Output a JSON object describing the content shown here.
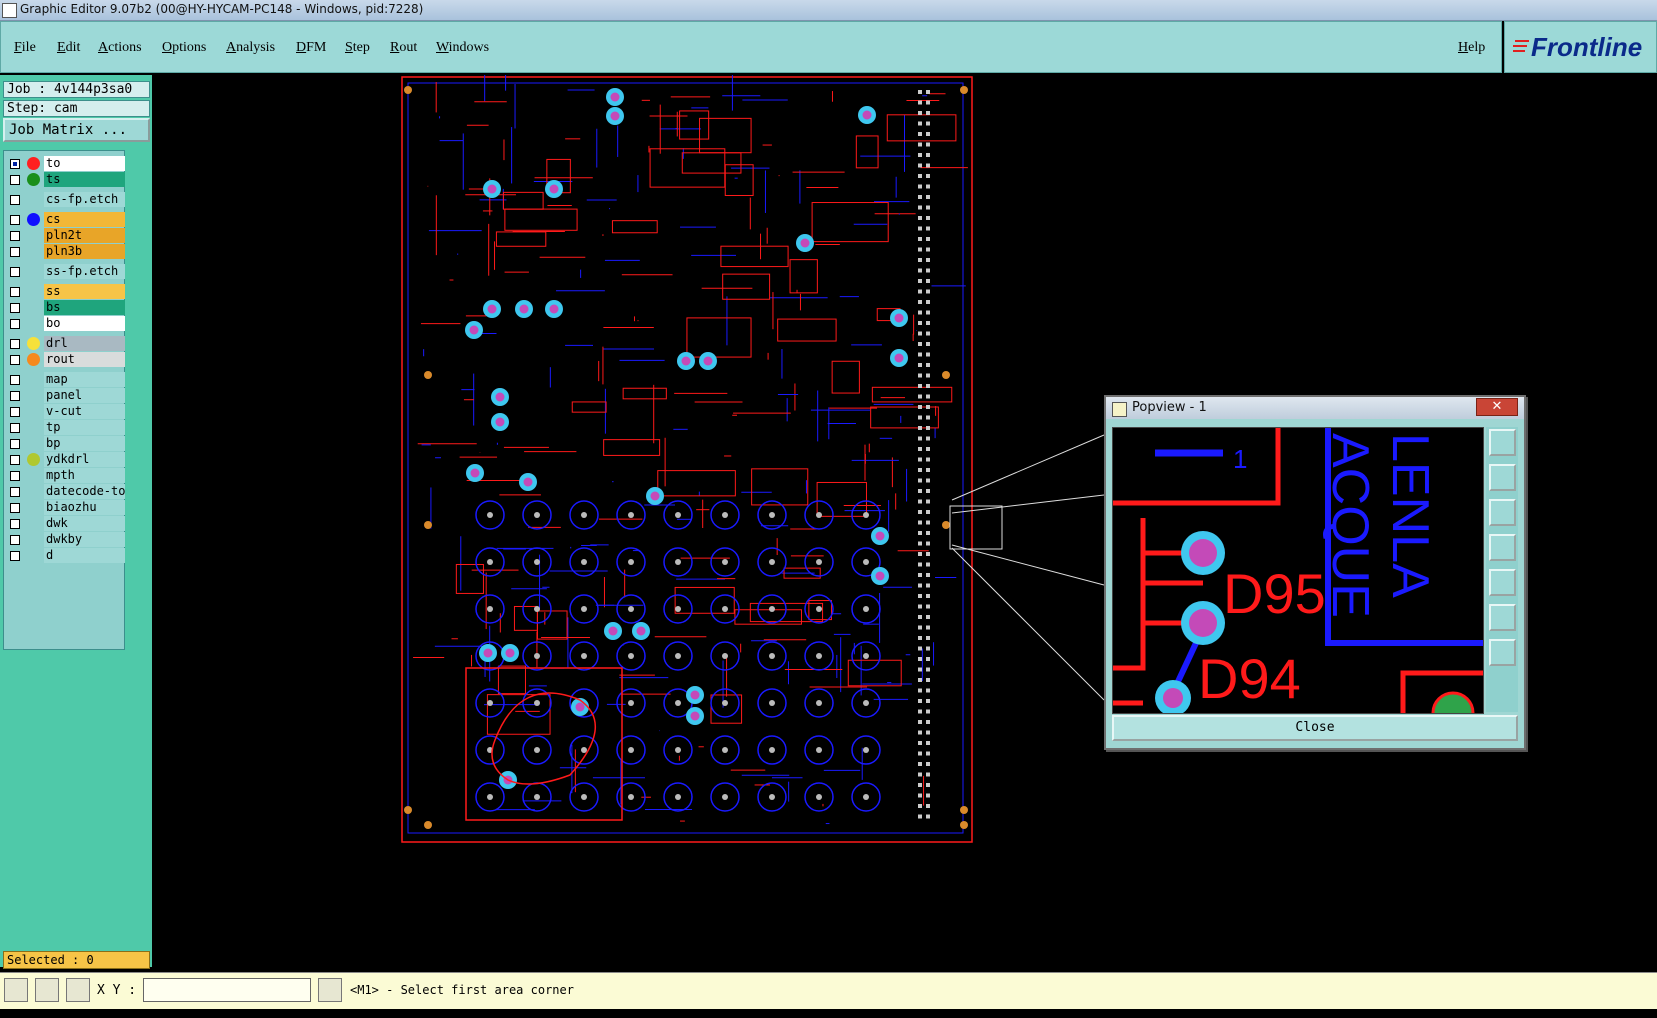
{
  "window": {
    "title": "Graphic Editor 9.07b2 (00@HY-HYCAM-PC148 - Windows, pid:7228)"
  },
  "menu": {
    "items": [
      {
        "label": "File"
      },
      {
        "label": "Edit"
      },
      {
        "label": "Actions"
      },
      {
        "label": "Options"
      },
      {
        "label": "Analysis"
      },
      {
        "label": "DFM"
      },
      {
        "label": "Step"
      },
      {
        "label": "Rout"
      },
      {
        "label": "Windows"
      }
    ],
    "help": "Help"
  },
  "brand": {
    "logo_text": "Frontline"
  },
  "job": {
    "job_line": "Job : 4v144p3sa0",
    "step_line": "Step: cam",
    "matrix_button": "Job Matrix ..."
  },
  "layers": [
    {
      "name": "to",
      "bg": "#ffffff",
      "dot": "#ff2020",
      "checked": true
    },
    {
      "name": "ts",
      "bg": "#1fa57d",
      "dot": "#1a8f1a",
      "checked": false
    },
    {
      "name": "cs-fp.etch",
      "bg": "#9ed8d6",
      "dot": "",
      "checked": false
    },
    {
      "name": "cs",
      "bg": "#f2b737",
      "dot": "#1010ff",
      "checked": false
    },
    {
      "name": "pln2t",
      "bg": "#e8a528",
      "dot": "",
      "checked": false
    },
    {
      "name": "pln3b",
      "bg": "#e8a528",
      "dot": "",
      "checked": false
    },
    {
      "name": "ss-fp.etch",
      "bg": "#9ed8d6",
      "dot": "",
      "checked": false
    },
    {
      "name": "ss",
      "bg": "#f6c447",
      "dot": "",
      "checked": false
    },
    {
      "name": "bs",
      "bg": "#1fa57d",
      "dot": "",
      "checked": false
    },
    {
      "name": "bo",
      "bg": "#ffffff",
      "dot": "",
      "checked": false
    },
    {
      "name": "drl",
      "bg": "#a9b9c2",
      "dot": "#f6e13a",
      "checked": false
    },
    {
      "name": "rout",
      "bg": "#d9dcdc",
      "dot": "#f5891e",
      "checked": false
    },
    {
      "name": "map",
      "bg": "#9ed8d6",
      "dot": "",
      "checked": false
    },
    {
      "name": "panel",
      "bg": "#9ed8d6",
      "dot": "",
      "checked": false
    },
    {
      "name": "v-cut",
      "bg": "#9ed8d6",
      "dot": "",
      "checked": false
    },
    {
      "name": "tp",
      "bg": "#9ed8d6",
      "dot": "",
      "checked": false
    },
    {
      "name": "bp",
      "bg": "#9ed8d6",
      "dot": "",
      "checked": false
    },
    {
      "name": "ydkdrl",
      "bg": "#9ed8d6",
      "dot": "#b0c830",
      "checked": false
    },
    {
      "name": "mpth",
      "bg": "#9ed8d6",
      "dot": "",
      "checked": false
    },
    {
      "name": "datecode-to",
      "bg": "#9ed8d6",
      "dot": "",
      "checked": false
    },
    {
      "name": "biaozhu",
      "bg": "#9ed8d6",
      "dot": "",
      "checked": false
    },
    {
      "name": "dwk",
      "bg": "#9ed8d6",
      "dot": "",
      "checked": false
    },
    {
      "name": "dwkby",
      "bg": "#9ed8d6",
      "dot": "",
      "checked": false
    },
    {
      "name": "d",
      "bg": "#9ed8d6",
      "dot": "",
      "checked": false
    }
  ],
  "status": {
    "selected": "Selected : 0",
    "xy_label": "X Y :",
    "xy_value": "",
    "message": "<M1> - Select first area corner"
  },
  "popview": {
    "title": "Popview - 1",
    "close_label": "Close",
    "zoom_labels": [
      "D95",
      "D94",
      "1",
      "LENLA",
      "ACQUE"
    ]
  },
  "colors": {
    "board_top_trace": "#ff1a1a",
    "board_bottom_trace": "#1a1aff",
    "pad_outer": "#3fc7ef",
    "pad_inner": "#c44ab8",
    "panel_teal": "#4fc9a9",
    "menu_teal": "#9cd9d7"
  }
}
